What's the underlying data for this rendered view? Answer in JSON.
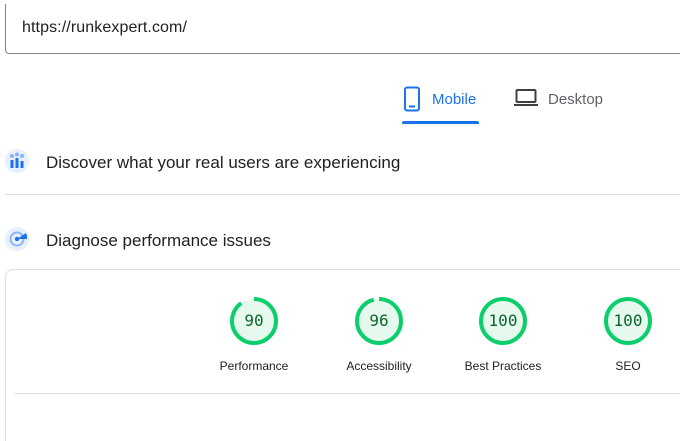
{
  "url_input": {
    "value": "https://runkexpert.com/"
  },
  "tabs": [
    {
      "label": "Mobile",
      "icon": "smartphone-icon",
      "selected": true
    },
    {
      "label": "Desktop",
      "icon": "laptop-icon",
      "selected": false
    }
  ],
  "sections": {
    "field_data": {
      "title": "Discover what your real users are experiencing",
      "icon": "users-chart-icon"
    },
    "lab_data": {
      "title": "Diagnose performance issues",
      "icon": "lighthouse-beam-icon"
    }
  },
  "scores": [
    {
      "label": "Performance",
      "value": "90",
      "fraction": 0.9
    },
    {
      "label": "Accessibility",
      "value": "96",
      "fraction": 0.96
    },
    {
      "label": "Best Practices",
      "value": "100",
      "fraction": 1.0
    },
    {
      "label": "SEO",
      "value": "100",
      "fraction": 1.0
    }
  ],
  "colors": {
    "accent": "#1a73e8",
    "score_pass_stroke": "#0cce6b",
    "score_pass_fill": "#e6f9ef",
    "score_pass_text": "#0d652d"
  }
}
